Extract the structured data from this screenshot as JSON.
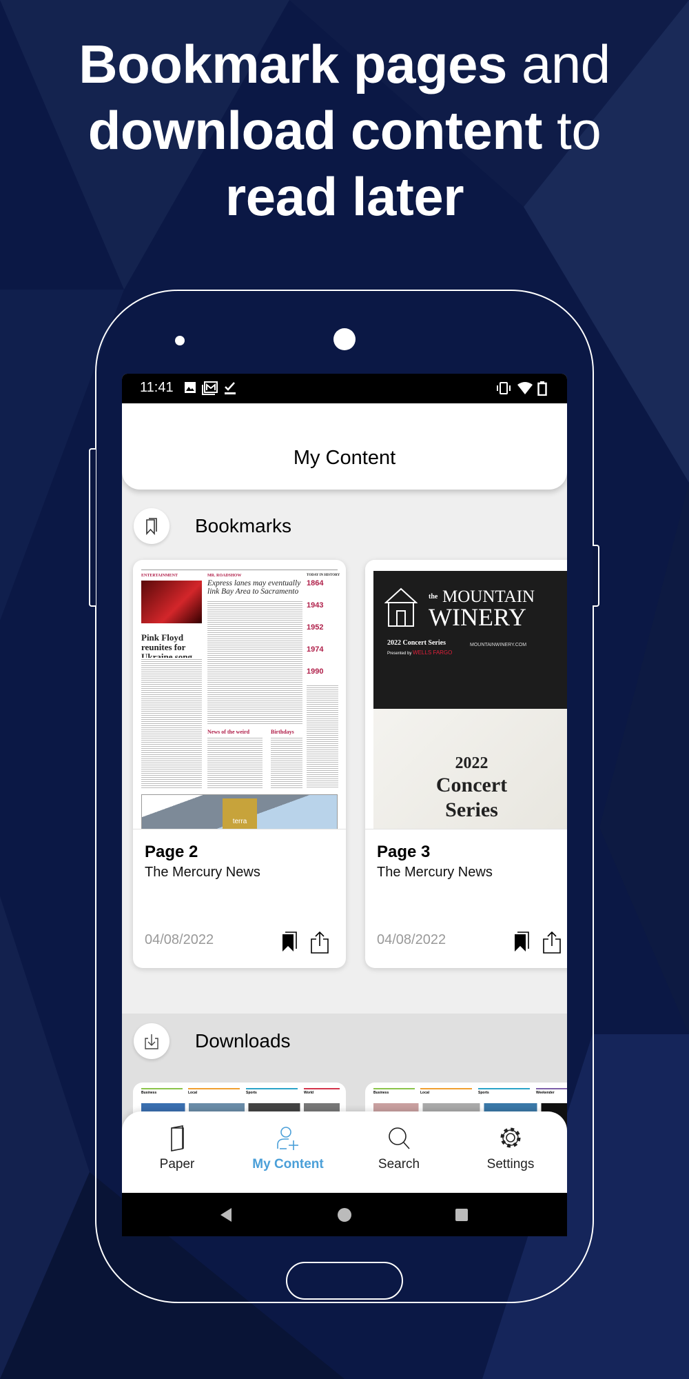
{
  "promo": {
    "line1_bold": "Bookmark pages",
    "line1_light": " and",
    "line2_bold": "download content",
    "line2_light": " to",
    "line3_bold": "read later"
  },
  "status_bar": {
    "time": "11:41",
    "icons": [
      "image-icon",
      "gmail-icon",
      "task-icon",
      "vibrate-icon",
      "wifi-icon",
      "battery-icon"
    ]
  },
  "header": {
    "title": "My Content"
  },
  "bookmarks": {
    "label": "Bookmarks",
    "icon": "bookmark-icon",
    "items": [
      {
        "title": "Page 2",
        "publication": "The Mercury News",
        "date": "04/08/2022",
        "thumb": {
          "section": "ENTERTAINMENT",
          "headline": "Pink Floyd reunites for Ukraine song",
          "roadshow": "MR. ROADSHOW",
          "roadshow_headline": "Express lanes may eventually link Bay Area to Sacramento",
          "history": "TODAY IN HISTORY",
          "years": [
            "1864",
            "1943",
            "1952",
            "1974",
            "1990"
          ],
          "weird": "News of the weird",
          "birthdays": "Birthdays",
          "ad": "terra"
        }
      },
      {
        "title": "Page 3",
        "publication": "The Mercury News",
        "date": "04/08/2022",
        "thumb": {
          "the": "the",
          "brand1": "MOUNTAIN",
          "brand2": "WINERY",
          "series": "2022 Concert Series",
          "presented": "Presented by",
          "sponsor": "WELLS FARGO",
          "site": "MOUNTAINWINERY.COM",
          "big1": "2022",
          "big2": "Concert",
          "big3": "Series"
        }
      }
    ]
  },
  "downloads": {
    "label": "Downloads",
    "icon": "download-icon",
    "items": [
      {
        "teasers": [
          "Business",
          "Local",
          "Sports",
          "World"
        ]
      },
      {
        "teasers": [
          "Business",
          "Local",
          "Sports",
          "Weekender"
        ]
      }
    ]
  },
  "bottom_nav": {
    "active": "My Content",
    "active_color": "#4a9fd8",
    "items": [
      {
        "label": "Paper",
        "icon": "paper-icon"
      },
      {
        "label": "My Content",
        "icon": "add-user-icon"
      },
      {
        "label": "Search",
        "icon": "search-icon"
      },
      {
        "label": "Settings",
        "icon": "gear-icon"
      }
    ]
  },
  "system_nav": {
    "icons": [
      "back-icon",
      "home-icon",
      "recents-icon"
    ]
  }
}
